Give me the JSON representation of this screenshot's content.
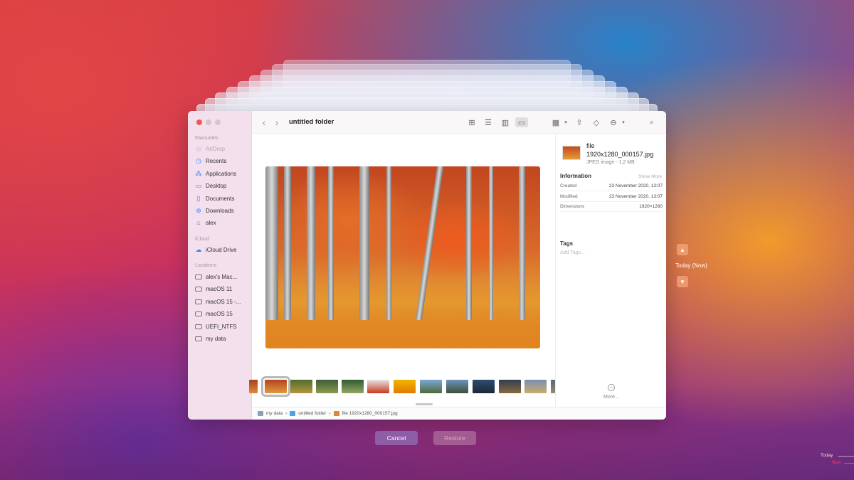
{
  "window": {
    "folder_title": "untitled folder"
  },
  "sidebar": {
    "favourites_label": "Favourites",
    "icloud_label": "iCloud",
    "locations_label": "Locations",
    "favourites": [
      {
        "label": "AirDrop",
        "icon": "airdrop-icon"
      },
      {
        "label": "Recents",
        "icon": "clock-icon"
      },
      {
        "label": "Applications",
        "icon": "applications-icon"
      },
      {
        "label": "Desktop",
        "icon": "desktop-icon"
      },
      {
        "label": "Documents",
        "icon": "document-icon"
      },
      {
        "label": "Downloads",
        "icon": "download-icon"
      },
      {
        "label": "alex",
        "icon": "home-icon"
      }
    ],
    "icloud": [
      {
        "label": "iCloud Drive",
        "icon": "cloud-icon"
      }
    ],
    "locations": [
      {
        "label": "alex's Mac...",
        "icon": "drive-icon"
      },
      {
        "label": "macOS 11",
        "icon": "drive-icon"
      },
      {
        "label": "macOS 15 -...",
        "icon": "drive-icon"
      },
      {
        "label": "macOS 15",
        "icon": "drive-icon"
      },
      {
        "label": "UEFI_NTFS",
        "icon": "drive-icon"
      },
      {
        "label": "my data",
        "icon": "drive-icon"
      }
    ]
  },
  "inspector": {
    "name_line1": "file",
    "name_line2": "1920x1280_000157.jpg",
    "type": "JPEG image - 1,2 MB",
    "information_label": "Information",
    "show_more": "Show More",
    "rows": [
      {
        "key": "Created",
        "value": "23 November 2020, 13:07"
      },
      {
        "key": "Modified",
        "value": "23 November 2020, 13:07"
      },
      {
        "key": "Dimensions",
        "value": "1920×1280"
      }
    ],
    "tags_label": "Tags",
    "add_tags": "Add Tags...",
    "more": "More..."
  },
  "pathbar": {
    "items": [
      "my data",
      "untitled folder",
      "file 1920x1280_000157.jpg"
    ],
    "separator": "›"
  },
  "buttons": {
    "cancel": "Cancel",
    "restore": "Restore"
  },
  "timeline": {
    "current": "Today (Now)",
    "today": "Today",
    "now": "Now"
  },
  "colors": {
    "accent": "#8d5ea6",
    "now_red": "#ff3b57",
    "sidebar_icon": "#3a82f6"
  }
}
